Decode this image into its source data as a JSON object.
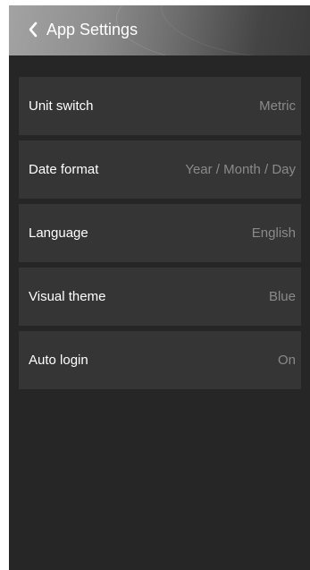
{
  "header": {
    "title": "App Settings",
    "back_icon": "chevron-left-icon"
  },
  "settings": [
    {
      "label": "Unit switch",
      "value": "Metric"
    },
    {
      "label": "Date format",
      "value": "Year / Month / Day"
    },
    {
      "label": "Language",
      "value": "English"
    },
    {
      "label": "Visual theme",
      "value": "Blue"
    },
    {
      "label": "Auto login",
      "value": "On"
    }
  ],
  "colors": {
    "background": "#262626",
    "row": "#353535",
    "label": "#ffffff",
    "value": "#8a8a8a"
  }
}
